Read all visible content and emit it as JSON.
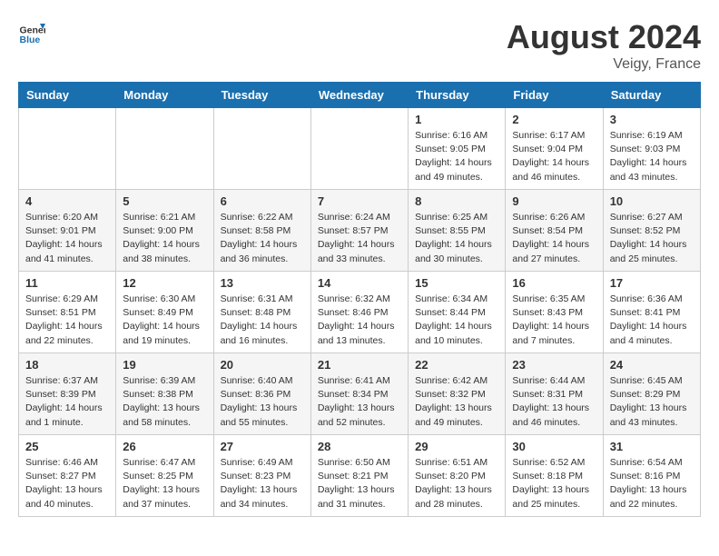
{
  "header": {
    "logo_general": "General",
    "logo_blue": "Blue",
    "month_year": "August 2024",
    "location": "Veigy, France"
  },
  "days_of_week": [
    "Sunday",
    "Monday",
    "Tuesday",
    "Wednesday",
    "Thursday",
    "Friday",
    "Saturday"
  ],
  "weeks": [
    [
      {
        "day": "",
        "info": ""
      },
      {
        "day": "",
        "info": ""
      },
      {
        "day": "",
        "info": ""
      },
      {
        "day": "",
        "info": ""
      },
      {
        "day": "1",
        "info": "Sunrise: 6:16 AM\nSunset: 9:05 PM\nDaylight: 14 hours\nand 49 minutes."
      },
      {
        "day": "2",
        "info": "Sunrise: 6:17 AM\nSunset: 9:04 PM\nDaylight: 14 hours\nand 46 minutes."
      },
      {
        "day": "3",
        "info": "Sunrise: 6:19 AM\nSunset: 9:03 PM\nDaylight: 14 hours\nand 43 minutes."
      }
    ],
    [
      {
        "day": "4",
        "info": "Sunrise: 6:20 AM\nSunset: 9:01 PM\nDaylight: 14 hours\nand 41 minutes."
      },
      {
        "day": "5",
        "info": "Sunrise: 6:21 AM\nSunset: 9:00 PM\nDaylight: 14 hours\nand 38 minutes."
      },
      {
        "day": "6",
        "info": "Sunrise: 6:22 AM\nSunset: 8:58 PM\nDaylight: 14 hours\nand 36 minutes."
      },
      {
        "day": "7",
        "info": "Sunrise: 6:24 AM\nSunset: 8:57 PM\nDaylight: 14 hours\nand 33 minutes."
      },
      {
        "day": "8",
        "info": "Sunrise: 6:25 AM\nSunset: 8:55 PM\nDaylight: 14 hours\nand 30 minutes."
      },
      {
        "day": "9",
        "info": "Sunrise: 6:26 AM\nSunset: 8:54 PM\nDaylight: 14 hours\nand 27 minutes."
      },
      {
        "day": "10",
        "info": "Sunrise: 6:27 AM\nSunset: 8:52 PM\nDaylight: 14 hours\nand 25 minutes."
      }
    ],
    [
      {
        "day": "11",
        "info": "Sunrise: 6:29 AM\nSunset: 8:51 PM\nDaylight: 14 hours\nand 22 minutes."
      },
      {
        "day": "12",
        "info": "Sunrise: 6:30 AM\nSunset: 8:49 PM\nDaylight: 14 hours\nand 19 minutes."
      },
      {
        "day": "13",
        "info": "Sunrise: 6:31 AM\nSunset: 8:48 PM\nDaylight: 14 hours\nand 16 minutes."
      },
      {
        "day": "14",
        "info": "Sunrise: 6:32 AM\nSunset: 8:46 PM\nDaylight: 14 hours\nand 13 minutes."
      },
      {
        "day": "15",
        "info": "Sunrise: 6:34 AM\nSunset: 8:44 PM\nDaylight: 14 hours\nand 10 minutes."
      },
      {
        "day": "16",
        "info": "Sunrise: 6:35 AM\nSunset: 8:43 PM\nDaylight: 14 hours\nand 7 minutes."
      },
      {
        "day": "17",
        "info": "Sunrise: 6:36 AM\nSunset: 8:41 PM\nDaylight: 14 hours\nand 4 minutes."
      }
    ],
    [
      {
        "day": "18",
        "info": "Sunrise: 6:37 AM\nSunset: 8:39 PM\nDaylight: 14 hours\nand 1 minute."
      },
      {
        "day": "19",
        "info": "Sunrise: 6:39 AM\nSunset: 8:38 PM\nDaylight: 13 hours\nand 58 minutes."
      },
      {
        "day": "20",
        "info": "Sunrise: 6:40 AM\nSunset: 8:36 PM\nDaylight: 13 hours\nand 55 minutes."
      },
      {
        "day": "21",
        "info": "Sunrise: 6:41 AM\nSunset: 8:34 PM\nDaylight: 13 hours\nand 52 minutes."
      },
      {
        "day": "22",
        "info": "Sunrise: 6:42 AM\nSunset: 8:32 PM\nDaylight: 13 hours\nand 49 minutes."
      },
      {
        "day": "23",
        "info": "Sunrise: 6:44 AM\nSunset: 8:31 PM\nDaylight: 13 hours\nand 46 minutes."
      },
      {
        "day": "24",
        "info": "Sunrise: 6:45 AM\nSunset: 8:29 PM\nDaylight: 13 hours\nand 43 minutes."
      }
    ],
    [
      {
        "day": "25",
        "info": "Sunrise: 6:46 AM\nSunset: 8:27 PM\nDaylight: 13 hours\nand 40 minutes."
      },
      {
        "day": "26",
        "info": "Sunrise: 6:47 AM\nSunset: 8:25 PM\nDaylight: 13 hours\nand 37 minutes."
      },
      {
        "day": "27",
        "info": "Sunrise: 6:49 AM\nSunset: 8:23 PM\nDaylight: 13 hours\nand 34 minutes."
      },
      {
        "day": "28",
        "info": "Sunrise: 6:50 AM\nSunset: 8:21 PM\nDaylight: 13 hours\nand 31 minutes."
      },
      {
        "day": "29",
        "info": "Sunrise: 6:51 AM\nSunset: 8:20 PM\nDaylight: 13 hours\nand 28 minutes."
      },
      {
        "day": "30",
        "info": "Sunrise: 6:52 AM\nSunset: 8:18 PM\nDaylight: 13 hours\nand 25 minutes."
      },
      {
        "day": "31",
        "info": "Sunrise: 6:54 AM\nSunset: 8:16 PM\nDaylight: 13 hours\nand 22 minutes."
      }
    ]
  ]
}
